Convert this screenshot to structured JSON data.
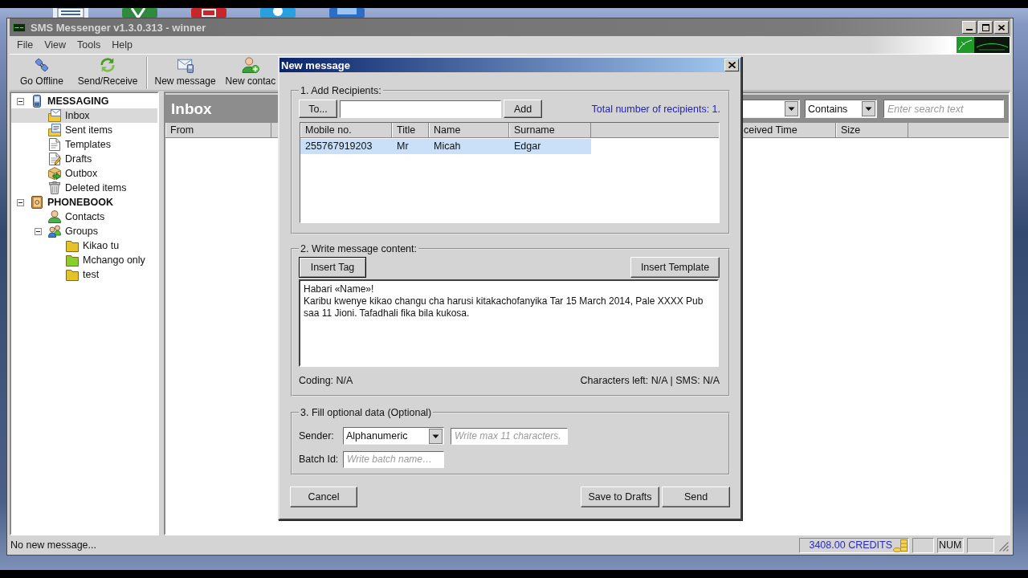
{
  "window": {
    "title": "SMS Messenger v1.3.0.313 - winner",
    "active": false
  },
  "menu": [
    "File",
    "View",
    "Tools",
    "Help"
  ],
  "toolbar": [
    {
      "buttons": [
        {
          "label": "Go Offline",
          "kind": "plug"
        },
        {
          "label": "Send/Receive",
          "kind": "sync"
        }
      ]
    },
    {
      "buttons": [
        {
          "label": "New message",
          "kind": "message"
        },
        {
          "label": "New contac",
          "kind": "add-contact"
        }
      ]
    }
  ],
  "sidebar": {
    "tree": [
      {
        "label": "MESSAGING",
        "kind": "phone",
        "selected": false,
        "expanded": true,
        "children": [
          {
            "label": "Inbox",
            "kind": "inbox",
            "selected": true
          },
          {
            "label": "Sent items",
            "kind": "sent",
            "selected": false
          },
          {
            "label": "Templates",
            "kind": "template",
            "selected": false
          },
          {
            "label": "Drafts",
            "kind": "draft",
            "selected": false
          },
          {
            "label": "Outbox",
            "kind": "outbox",
            "selected": false
          },
          {
            "label": "Deleted items",
            "kind": "trash",
            "selected": false
          }
        ]
      },
      {
        "label": "PHONEBOOK",
        "kind": "addressbook",
        "selected": false,
        "expanded": true,
        "children": [
          {
            "label": "Contacts",
            "kind": "contact",
            "selected": false
          },
          {
            "label": "Groups",
            "kind": "group",
            "selected": false,
            "expanded": true,
            "children": [
              {
                "label": "Kikao tu",
                "kind": "folder",
                "color": "#e6c229",
                "selected": false
              },
              {
                "label": "Mchango only",
                "kind": "folder",
                "color": "#86cf2e",
                "selected": false
              },
              {
                "label": "test",
                "kind": "folder",
                "color": "#e6c229",
                "selected": false
              }
            ]
          }
        ]
      }
    ]
  },
  "inbox": {
    "title": "Inbox",
    "match": "Contains",
    "search": {
      "placeholder": "Enter search text"
    },
    "columns": [
      "From",
      "ceived Time",
      "Size"
    ]
  },
  "status_bar": {
    "message": "No new message...",
    "credits": "3408.00 CREDITS",
    "num_lock": "NUM"
  },
  "dialog": {
    "title": "New message",
    "recipients": {
      "legend": "1. Add Recipients:",
      "to_button": "To...",
      "add_button": "Add",
      "total": "Total number of recipients: 1.",
      "columns": [
        "Mobile no.",
        "Title",
        "Name",
        "Surname"
      ],
      "rows": [
        {
          "cells": [
            "255767919203",
            "Mr",
            "Micah",
            "Edgar"
          ],
          "selected": true
        }
      ]
    },
    "content": {
      "legend": "2. Write message content:",
      "insert_tag": "Insert Tag",
      "insert_template": "Insert Template",
      "message": "Habari «Name»!\nKaribu kwenye kikao changu cha harusi kitakachofanyika Tar 15 March 2014, Pale XXXX Pub saa 11 Jioni. Tafadhali fika bila kukosa.",
      "coding": "Coding: N/A",
      "counter": "Characters left: N/A | SMS: N/A"
    },
    "optional": {
      "legend": "3. Fill optional data (Optional)",
      "sender_label": "Sender:",
      "sender_type": "Alphanumeric",
      "sender": {
        "placeholder": "Write max 11 characters."
      },
      "batch_label": "Batch Id:",
      "batch_id": {
        "placeholder": "Write batch name…"
      }
    },
    "cancel_button": "Cancel",
    "save_button": "Save to Drafts",
    "send_button": "Send"
  }
}
